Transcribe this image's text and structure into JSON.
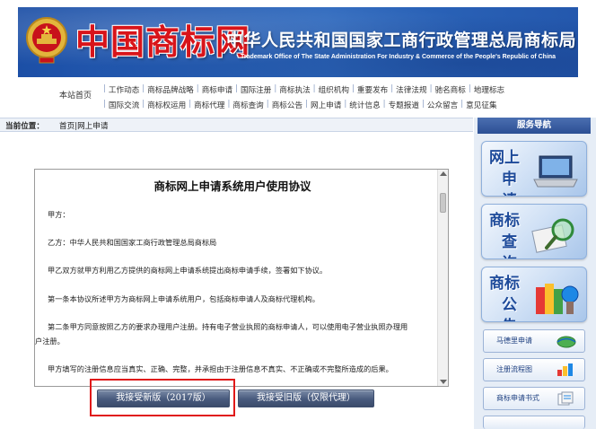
{
  "header": {
    "logo_text": "中国商标网",
    "title": "中华人民共和国国家工商行政管理总局商标局",
    "subtitle": "Trademark Office of The State Administration For Industry & Commerce of the People's Republic of China"
  },
  "nav": {
    "home": "本站首页",
    "row1": [
      "工作动态",
      "商标品牌战略",
      "商标申请",
      "国际注册",
      "商标执法",
      "组织机构",
      "重要发布",
      "法律法规",
      "驰名商标",
      "地理标志"
    ],
    "row2": [
      "国际交流",
      "商标权运用",
      "商标代理",
      "商标查询",
      "商标公告",
      "网上申请",
      "统计信息",
      "专题报道",
      "公众留言",
      "意见征集"
    ]
  },
  "location": {
    "label": "当前位置：",
    "path": "首页|网上申请"
  },
  "agreement": {
    "title": "商标网上申请系统用户使用协议",
    "paragraphs": [
      "甲方：",
      "乙方：中华人民共和国国家工商行政管理总局商标局",
      "甲乙双方就甲方利用乙方提供的商标网上申请系统提出商标申请手续，签署如下协议。",
      "第一条本协议所述甲方为商标网上申请系统用户，包括商标申请人及商标代理机构。",
      "第二条甲方同意按照乙方的要求办理用户注册。持有电子营业执照的商标申请人，可以使用电子营业执照办理用",
      "户注册。",
      "甲方填写的注册信息应当真实、正确、完整，并承担由于注册信息不真实、不正确或不完整所造成的后果。"
    ],
    "btn_new": "我接受新版（2017版）",
    "btn_old": "我接受旧版（仅限代理）"
  },
  "sidebar": {
    "header": "服务导航",
    "big": [
      {
        "line1": "网上",
        "line2": "申请",
        "icon": "laptop-icon"
      },
      {
        "line1": "商标",
        "line2": "查询",
        "icon": "magnifier-icon"
      },
      {
        "line1": "商标",
        "line2": "公告",
        "icon": "books-icon"
      }
    ],
    "small": [
      {
        "label": "马德里申请",
        "icon": "globe-icon"
      },
      {
        "label": "注册流程图",
        "icon": "chart-icon"
      },
      {
        "label": "商标申请书式",
        "icon": "documents-icon"
      }
    ]
  }
}
